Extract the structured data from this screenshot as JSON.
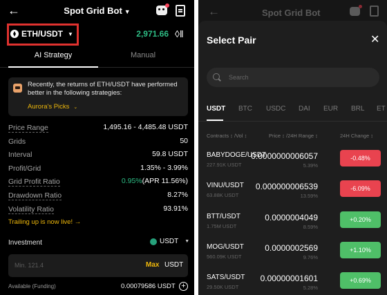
{
  "left": {
    "title": "Spot Grid Bot",
    "pair": "ETH/USDT",
    "price": "2,971.66",
    "tabs": [
      "AI Strategy",
      "Manual"
    ],
    "notice": {
      "text": "Recently, the returns of ETH/USDT have performed better in the following strategies:",
      "link": "Aurora's Picks"
    },
    "stats": [
      {
        "label": "Price Range",
        "value": "1,495.16 - 4,485.48 USDT"
      },
      {
        "label": "Grids",
        "value": "50"
      },
      {
        "label": "Interval",
        "value": "59.8 USDT"
      },
      {
        "label": "Profit/Grid",
        "value": "1.35% - 3.99%"
      },
      {
        "label": "Grid Profit Ratio",
        "value_green": "0.95%",
        "value_rest": "(APR 11.56%)"
      },
      {
        "label": "Drawdown Ratio",
        "value": "8.27%"
      },
      {
        "label": "Volatility Ratio",
        "value": "93.91%"
      }
    ],
    "trailing": "Trailing up is now live! →",
    "investment": {
      "label": "Investment",
      "currency": "USDT",
      "placeholder": "Min. 121.4",
      "max": "Max",
      "unit": "USDT",
      "available_label": "Available (Funding)",
      "available_value": "0.00079586 USDT"
    }
  },
  "right": {
    "bg_title": "Spot Grid Bot",
    "sheet_title": "Select Pair",
    "search_placeholder": "Search",
    "quote_tabs": [
      "USDT",
      "BTC",
      "USDC",
      "DAI",
      "EUR",
      "BRL",
      "ET"
    ],
    "columns": {
      "contracts": "Contracts ↕ /Vol ↕",
      "price": "Price ↕ /24H Range ↕",
      "change": "24H Change ↕"
    },
    "rows": [
      {
        "symbol": "BABYDOGE/USDT",
        "volume": "227.91K USDT",
        "price": "0.0000000006057",
        "range": "5.39%",
        "change": "-0.48%",
        "direction": "down"
      },
      {
        "symbol": "VINU/USDT",
        "volume": "63.88K USDT",
        "price": "0.000000006539",
        "range": "13.59%",
        "change": "-6.09%",
        "direction": "down"
      },
      {
        "symbol": "BTT/USDT",
        "volume": "1.75M USDT",
        "price": "0.0000004049",
        "range": "8.59%",
        "change": "+0.20%",
        "direction": "up"
      },
      {
        "symbol": "MOG/USDT",
        "volume": "560.09K USDT",
        "price": "0.0000002569",
        "range": "9.76%",
        "change": "+1.10%",
        "direction": "up"
      },
      {
        "symbol": "SATS/USDT",
        "volume": "29.50K USDT",
        "price": "0.00000001601",
        "range": "5.28%",
        "change": "+0.69%",
        "direction": "up"
      }
    ]
  },
  "colors": {
    "up": "#4fbf68",
    "down": "#e9434f",
    "accent": "#f0b90b",
    "highlight_box": "#e0322f"
  }
}
